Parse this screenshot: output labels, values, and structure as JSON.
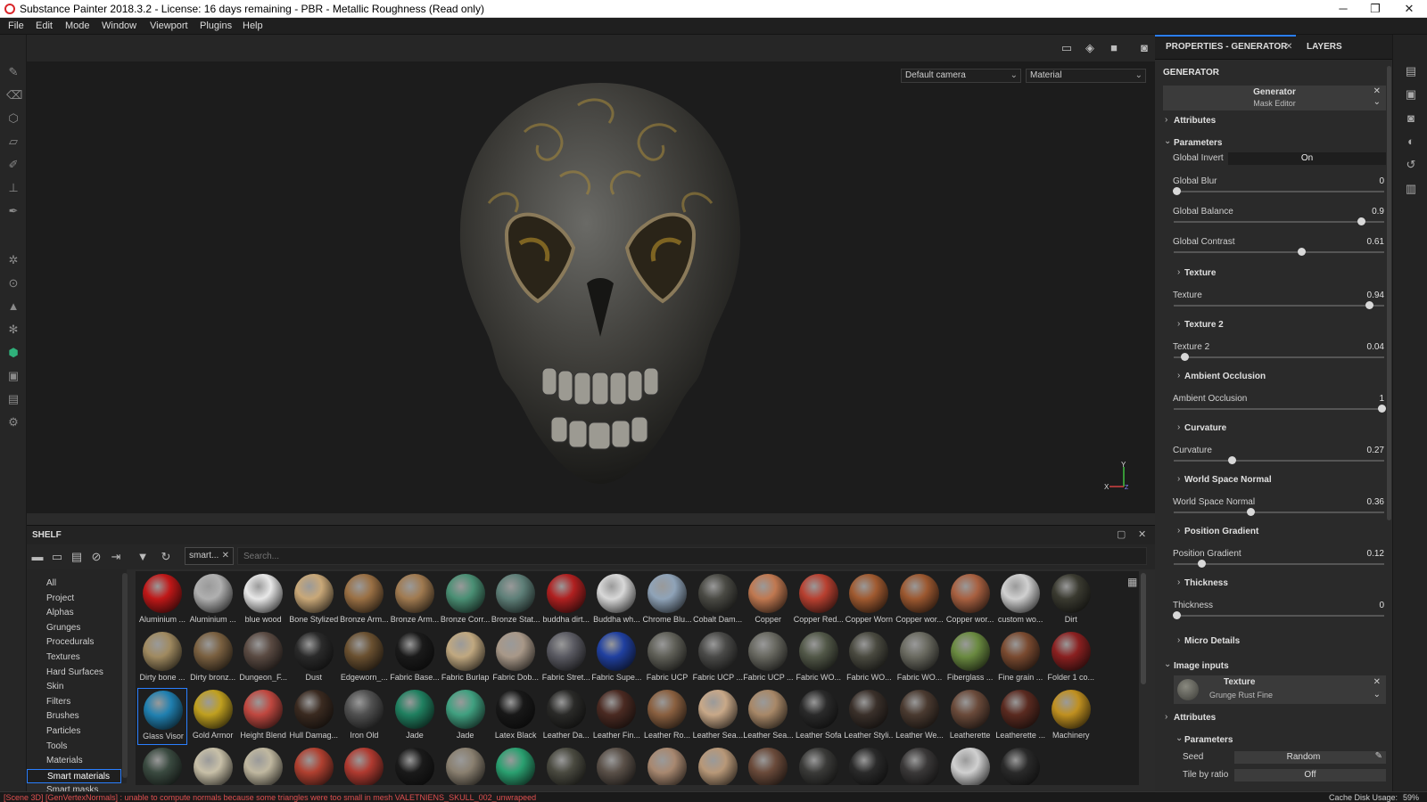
{
  "titlebar": {
    "title": "Substance Painter 2018.3.2 - License: 16 days remaining - PBR - Metallic Roughness (Read only)",
    "minimize_glyph": "─",
    "maximize_glyph": "❐",
    "close_glyph": "✕"
  },
  "menu": [
    "File",
    "Edit",
    "Mode",
    "Window",
    "Viewport",
    "Plugins",
    "Help"
  ],
  "viewport": {
    "camera": "Default camera",
    "mode": "Material",
    "axis_x": "X",
    "axis_y": "Y",
    "axis_z": "Z"
  },
  "shelf": {
    "title": "SHELF",
    "filter_chip": "smart...",
    "search_placeholder": "Search...",
    "categories": [
      "All",
      "Project",
      "Alphas",
      "Grunges",
      "Procedurals",
      "Textures",
      "Hard Surfaces",
      "Skin",
      "Filters",
      "Brushes",
      "Particles",
      "Tools",
      "Materials",
      "Smart materials",
      "Smart masks"
    ],
    "selected_category": "Smart materials",
    "materials": [
      {
        "name": "Aluminium ...",
        "color": "#c01818"
      },
      {
        "name": "Aluminium ...",
        "color": "#b0b0b0"
      },
      {
        "name": "blue wood",
        "color": "#e8e8e8"
      },
      {
        "name": "Bone Stylized",
        "color": "#c9a878"
      },
      {
        "name": "Bronze Arm...",
        "color": "#9a7044"
      },
      {
        "name": "Bronze Arm...",
        "color": "#a07a50"
      },
      {
        "name": "Bronze Corr...",
        "color": "#4a8f74"
      },
      {
        "name": "Bronze Stat...",
        "color": "#5e7f78"
      },
      {
        "name": "buddha dirt...",
        "color": "#b02020"
      },
      {
        "name": "Buddha wh...",
        "color": "#d8d8d8"
      },
      {
        "name": "Chrome Blu...",
        "color": "#8fa3b8"
      },
      {
        "name": "Cobalt Dam...",
        "color": "#4a4a44"
      },
      {
        "name": "Copper",
        "color": "#c07850"
      },
      {
        "name": "Copper Red...",
        "color": "#b84030"
      },
      {
        "name": "Copper Worn",
        "color": "#a05a30"
      },
      {
        "name": "Copper wor...",
        "color": "#9c5830"
      },
      {
        "name": "Copper wor...",
        "color": "#a86040"
      },
      {
        "name": "custom wo...",
        "color": "#d0d0d0"
      },
      {
        "name": "Dirt",
        "color": "#3a3a30"
      },
      {
        "name": "Dirty bone ...",
        "color": "#a08a60"
      },
      {
        "name": "Dirty bronz...",
        "color": "#7a6040"
      },
      {
        "name": "Dungeon_F...",
        "color": "#5a4a42"
      },
      {
        "name": "Dust",
        "color": "#2a2a2a"
      },
      {
        "name": "Edgeworn_...",
        "color": "#6a5030"
      },
      {
        "name": "Fabric Base...",
        "color": "#1a1a1a"
      },
      {
        "name": "Fabric Burlap",
        "color": "#c0a880"
      },
      {
        "name": "Fabric Dob...",
        "color": "#a89888"
      },
      {
        "name": "Fabric Stret...",
        "color": "#5a5a62"
      },
      {
        "name": "Fabric Supe...",
        "color": "#2040a0"
      },
      {
        "name": "Fabric UCP",
        "color": "#606058"
      },
      {
        "name": "Fabric UCP ...",
        "color": "#4a4a48"
      },
      {
        "name": "Fabric UCP ...",
        "color": "#686860"
      },
      {
        "name": "Fabric WO...",
        "color": "#525848"
      },
      {
        "name": "Fabric WO...",
        "color": "#4a4a40"
      },
      {
        "name": "Fabric WO...",
        "color": "#6a6a60"
      },
      {
        "name": "Fiberglass ...",
        "color": "#6a8a40"
      },
      {
        "name": "Fine grain ...",
        "color": "#7a4a30"
      },
      {
        "name": "Folder 1 co...",
        "color": "#8a2020"
      },
      {
        "name": "Glass Visor",
        "color": "#2080b0"
      },
      {
        "name": "Gold Armor",
        "color": "#c0a020"
      },
      {
        "name": "Height Blend",
        "color": "#c04840"
      },
      {
        "name": "Hull Damag...",
        "color": "#3a2a20"
      },
      {
        "name": "Iron Old",
        "color": "#505050"
      },
      {
        "name": "Jade",
        "color": "#208060"
      },
      {
        "name": "Jade",
        "color": "#40a080"
      },
      {
        "name": "Latex Black",
        "color": "#181818"
      },
      {
        "name": "Leather Da...",
        "color": "#2a2a28"
      },
      {
        "name": "Leather Fin...",
        "color": "#4a2a22"
      },
      {
        "name": "Leather Ro...",
        "color": "#8a6040"
      },
      {
        "name": "Leather Sea...",
        "color": "#c8a888"
      },
      {
        "name": "Leather Sea...",
        "color": "#a88868"
      },
      {
        "name": "Leather Sofa",
        "color": "#2a2a2a"
      },
      {
        "name": "Leather Styli...",
        "color": "#3a302a"
      },
      {
        "name": "Leather We...",
        "color": "#4a3a30"
      },
      {
        "name": "Leatherette",
        "color": "#6a4a3a"
      },
      {
        "name": "Leatherette ...",
        "color": "#5a2a20"
      },
      {
        "name": "Machinery",
        "color": "#c09020"
      }
    ],
    "partial_row": [
      "#3a4a40",
      "#c8c0a8",
      "#c0b8a0",
      "#b04030",
      "#b03a30",
      "#1a1a1a",
      "#8a8070",
      "#2aa070",
      "#4a4a40",
      "#5a5048",
      "#a88870",
      "#b89878",
      "#6a4a3a",
      "#3a3a38",
      "#2a2a2a",
      "#3a3838",
      "#d0d0d0",
      "#2a2a2a"
    ]
  },
  "properties": {
    "tab_properties": "PROPERTIES - GENERATOR",
    "tab_layers": "LAYERS",
    "section": "GENERATOR",
    "generator_name": "Generator",
    "generator_sub": "Mask Editor",
    "attributes": "Attributes",
    "parameters": "Parameters",
    "global_invert_label": "Global Invert",
    "global_invert_value": "On",
    "sliders": [
      {
        "label": "Global Blur",
        "value": "0",
        "fraction": 0.0
      },
      {
        "label": "Global Balance",
        "value": "0.9",
        "fraction": 0.9
      },
      {
        "label": "Global Contrast",
        "value": "0.61",
        "fraction": 0.61
      }
    ],
    "groups": [
      {
        "title": "Texture",
        "label": "Texture",
        "value": "0.94",
        "fraction": 0.94
      },
      {
        "title": "Texture 2",
        "label": "Texture 2",
        "value": "0.04",
        "fraction": 0.04
      },
      {
        "title": "Ambient Occlusion",
        "label": "Ambient Occlusion",
        "value": "1",
        "fraction": 1.0
      },
      {
        "title": "Curvature",
        "label": "Curvature",
        "value": "0.27",
        "fraction": 0.27
      },
      {
        "title": "World Space Normal",
        "label": "World Space Normal",
        "value": "0.36",
        "fraction": 0.36
      },
      {
        "title": "Position Gradient",
        "label": "Position Gradient",
        "value": "0.12",
        "fraction": 0.12
      },
      {
        "title": "Thickness",
        "label": "Thickness",
        "value": "0",
        "fraction": 0.0
      }
    ],
    "micro_details": "Micro Details",
    "image_inputs": "Image inputs",
    "texture_name": "Texture",
    "texture_sub": "Grunge Rust Fine",
    "attributes2": "Attributes",
    "parameters2": "Parameters",
    "seed_label": "Seed",
    "seed_value": "Random",
    "tile_label": "Tile by ratio",
    "tile_value": "Off"
  },
  "status": {
    "message": "[Scene 3D] [GenVertexNormals] : unable to compute normals because some triangles were too small in mesh VALETNIENS_SKULL_002_unwrapeed",
    "cache_label": "Cache Disk Usage:",
    "cache_value": "59%",
    "message_color": "#e05050"
  }
}
